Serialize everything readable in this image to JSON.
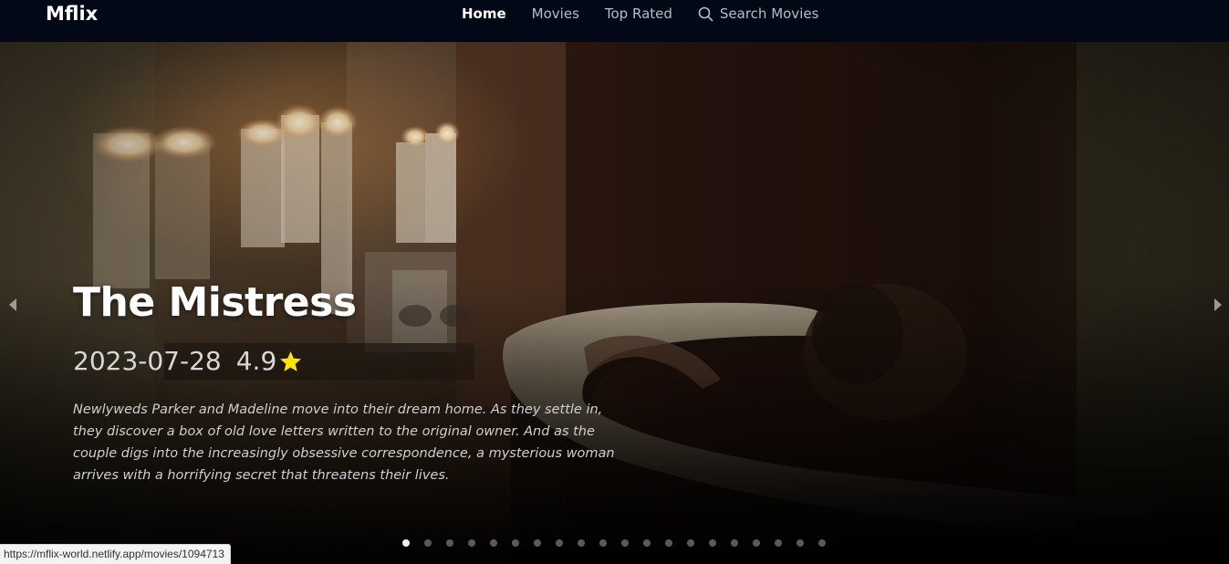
{
  "navbar": {
    "brand": "Mflix",
    "links": [
      {
        "label": "Home",
        "active": true
      },
      {
        "label": "Movies",
        "active": false
      },
      {
        "label": "Top Rated",
        "active": false
      }
    ],
    "search_label": "Search Movies"
  },
  "hero": {
    "title": "The Mistress",
    "release_date": "2023-07-28",
    "rating": "4.9",
    "overview": "Newlyweds Parker and Madeline move into their dream home. As they settle in, they discover a box of old love letters written to the original owner. And as the couple digs into the increasingly obsessive correspondence, a mysterious woman arrives with a horrifying secret that threatens their lives.",
    "star_color": "#ffe20a"
  },
  "carousel": {
    "slide_count": 20,
    "active_index": 0
  },
  "status_bar": {
    "url": "https://mflix-world.netlify.app/movies/1094713"
  },
  "colors": {
    "navbar_bg": "#020816",
    "dot_active": "#f2f2f2",
    "dot_inactive": "#5a5a5a"
  }
}
